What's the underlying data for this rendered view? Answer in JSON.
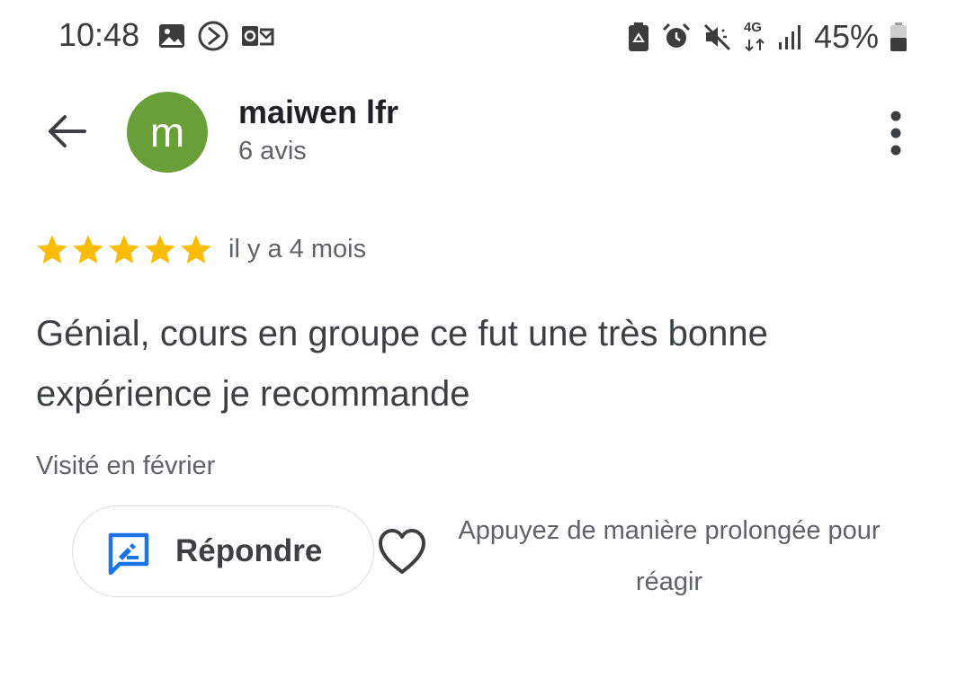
{
  "status_bar": {
    "time": "10:48",
    "battery_percent": "45%",
    "network_label": "4G",
    "left_icons": [
      "image-icon",
      "circle-play-icon",
      "outlook-icon"
    ],
    "right_icons": [
      "recycle-battery-icon",
      "alarm-icon",
      "mute-icon",
      "network-4g-icon",
      "signal-icon",
      "battery-icon"
    ]
  },
  "header": {
    "avatar_letter": "m",
    "avatar_color": "#689f38",
    "reviewer_name": "maiwen lfr",
    "review_count": "6 avis"
  },
  "review": {
    "rating": 5,
    "max_rating": 5,
    "star_color": "#fbbc04",
    "time_ago": "il y a 4 mois",
    "text": "Génial, cours en groupe ce fut une très bonne expérience je recommande",
    "visit_info": "Visité en février"
  },
  "actions": {
    "reply_label": "Répondre",
    "reply_icon_color": "#1a73e8",
    "react_hint": "Appuyez de manière prolongée pour réagir"
  }
}
